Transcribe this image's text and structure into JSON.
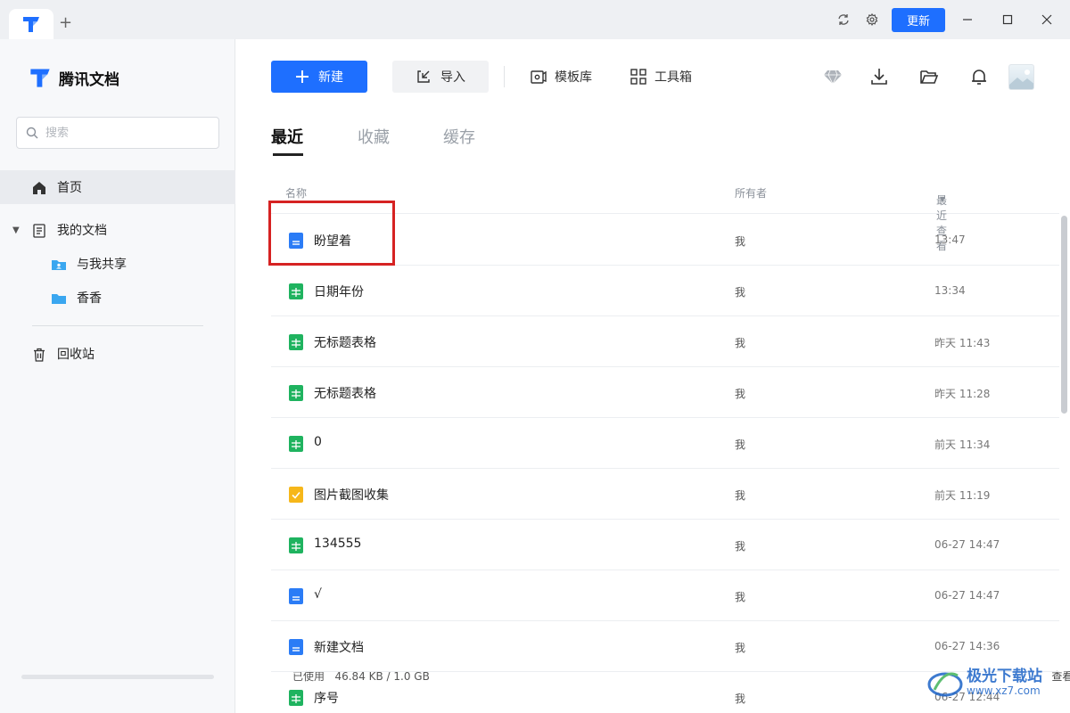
{
  "titlebar": {
    "new_tab_symbol": "+",
    "update_label": "更新",
    "icons": [
      "refresh-icon",
      "settings-icon"
    ],
    "window_controls": [
      "minimize-icon",
      "maximize-icon",
      "close-icon"
    ]
  },
  "sidebar": {
    "brand": "腾讯文档",
    "search_placeholder": "搜索",
    "nav": {
      "home": "首页",
      "my_docs": "我的文档",
      "shared": "与我共享",
      "folder": "香香",
      "trash": "回收站"
    },
    "storage": {
      "used_label": "已使用",
      "used_value": "46.84 KB / 1.0 GB",
      "view_label": "查看",
      "view_chevron": "›",
      "used_fraction": 0.0
    }
  },
  "toolbar": {
    "new_label": "新建",
    "import_label": "导入",
    "templates_label": "模板库",
    "tools_label": "工具箱",
    "icons": [
      "diamond-icon",
      "download-icon",
      "folder-open-icon",
      "bell-icon",
      "avatar"
    ]
  },
  "tabs": [
    "最近",
    "收藏",
    "缓存"
  ],
  "table": {
    "columns": {
      "name": "名称",
      "owner": "所有者",
      "time": "最近查看",
      "sort_indicator": "▾"
    },
    "rows": [
      {
        "name": "盼望着",
        "owner": "我",
        "time": "13:47",
        "type": "doc"
      },
      {
        "name": "日期年份",
        "owner": "我",
        "time": "13:34",
        "type": "sheet"
      },
      {
        "name": "无标题表格",
        "owner": "我",
        "time": "昨天 11:43",
        "type": "sheet"
      },
      {
        "name": "无标题表格",
        "owner": "我",
        "time": "昨天 11:28",
        "type": "sheet"
      },
      {
        "name": "0",
        "owner": "我",
        "time": "前天 11:34",
        "type": "sheet"
      },
      {
        "name": "图片截图收集",
        "owner": "我",
        "time": "前天 11:19",
        "type": "form"
      },
      {
        "name": "134555",
        "owner": "我",
        "time": "06-27 14:47",
        "type": "sheet"
      },
      {
        "name": "√",
        "owner": "我",
        "time": "06-27 14:47",
        "type": "doc"
      },
      {
        "name": "新建文档",
        "owner": "我",
        "time": "06-27 14:36",
        "type": "doc"
      },
      {
        "name": "序号",
        "owner": "我",
        "time": "06-27 12:44",
        "type": "sheet"
      }
    ]
  },
  "colors": {
    "accent": "#1e6fff",
    "doc": "#2b7cf6",
    "sheet": "#1fb35f",
    "form": "#f6b71a",
    "highlight": "#d62222"
  },
  "watermark": {
    "title": "极光下载站",
    "url": "www.xz7.com"
  }
}
